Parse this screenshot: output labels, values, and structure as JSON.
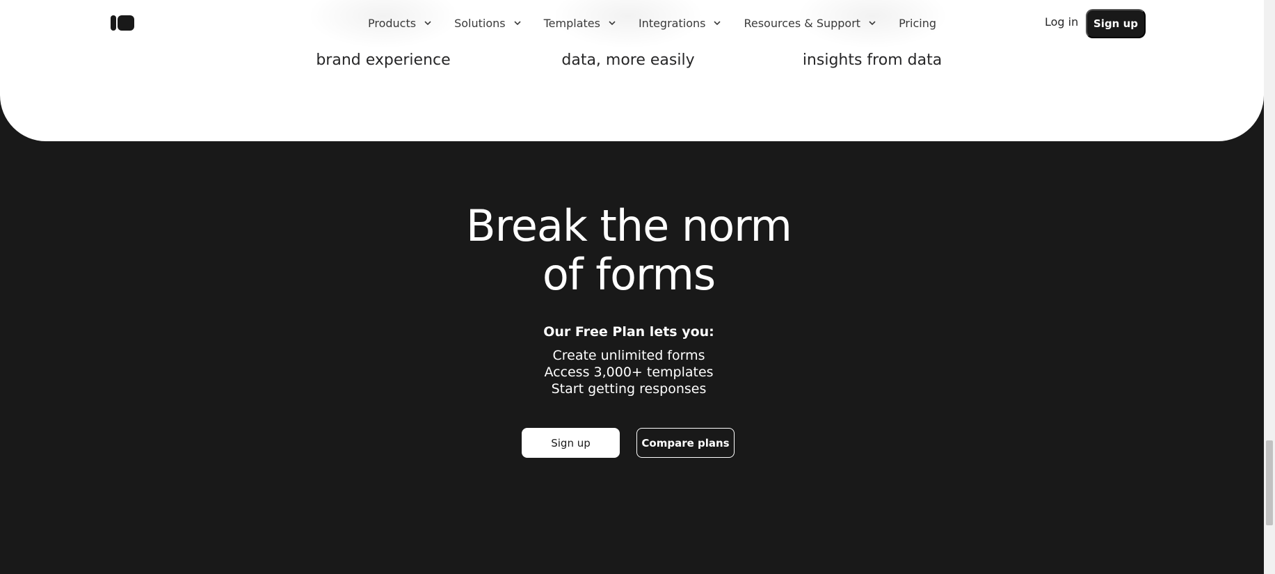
{
  "nav": {
    "logo_icon": "typeform-logo-icon",
    "items": [
      {
        "label": "Products",
        "has_dropdown": true
      },
      {
        "label": "Solutions",
        "has_dropdown": true
      },
      {
        "label": "Templates",
        "has_dropdown": true
      },
      {
        "label": "Integrations",
        "has_dropdown": true
      },
      {
        "label": "Resources & Support",
        "has_dropdown": true
      },
      {
        "label": "Pricing",
        "has_dropdown": false
      }
    ],
    "login_label": "Log in",
    "signup_label": "Sign up"
  },
  "features": [
    {
      "caption": "brand experience"
    },
    {
      "caption": "data, more easily"
    },
    {
      "caption": "insights from data"
    }
  ],
  "hero": {
    "title_line1": "Break the norm",
    "title_line2": "of forms",
    "subhead": "Our Free Plan lets you:",
    "benefits": [
      "Create unlimited forms",
      "Access 3,000+ templates",
      "Start getting responses"
    ],
    "primary_cta": "Sign up",
    "secondary_cta": "Compare plans"
  },
  "colors": {
    "dark_bg": "#191919",
    "panel_bg": "#ffffff",
    "text_dark": "#262627",
    "text_light": "#ffffff"
  }
}
